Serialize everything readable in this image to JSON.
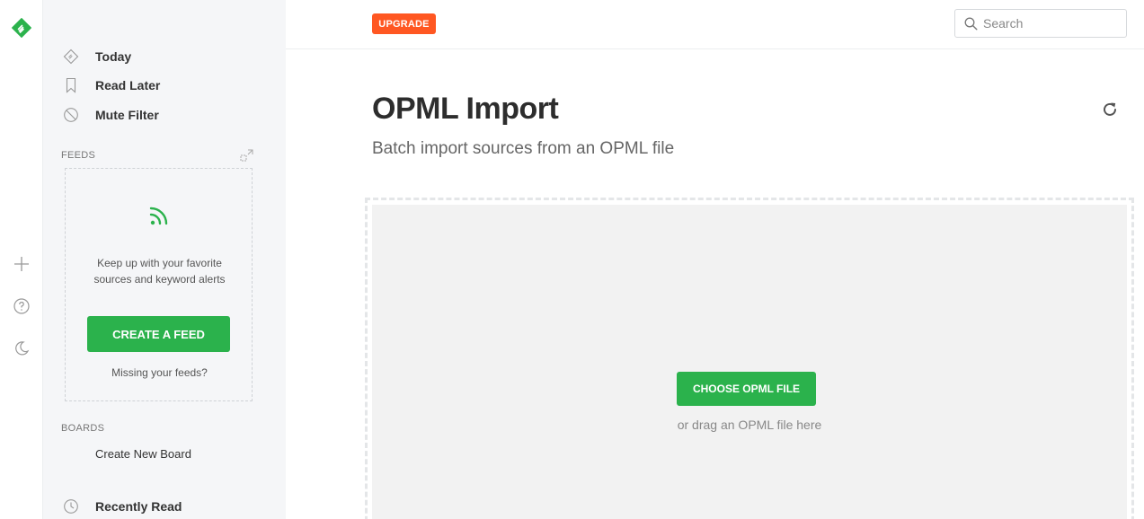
{
  "rail": {
    "icons": [
      "feedly-logo",
      "plus-icon",
      "help-icon",
      "moon-icon"
    ]
  },
  "sidebar": {
    "nav": [
      {
        "label": "Today",
        "icon": "today-icon"
      },
      {
        "label": "Read Later",
        "icon": "bookmark-icon"
      },
      {
        "label": "Mute Filter",
        "icon": "mute-icon"
      }
    ],
    "feeds_title": "FEEDS",
    "feeds_desc_line1": "Keep up with your favorite",
    "feeds_desc_line2": "sources and keyword alerts",
    "create_feed_label": "CREATE A FEED",
    "missing_feeds": "Missing your feeds?",
    "boards_title": "BOARDS",
    "create_board": "Create New Board",
    "recently_read": "Recently Read"
  },
  "header": {
    "upgrade_label": "UPGRADE",
    "search_placeholder": "Search"
  },
  "main": {
    "title": "OPML Import",
    "subtitle": "Batch import sources from an OPML file",
    "choose_label": "CHOOSE OPML FILE",
    "drag_text": "or drag an OPML file here"
  },
  "colors": {
    "accent_green": "#2bb24c",
    "upgrade_orange": "#ff5722"
  }
}
